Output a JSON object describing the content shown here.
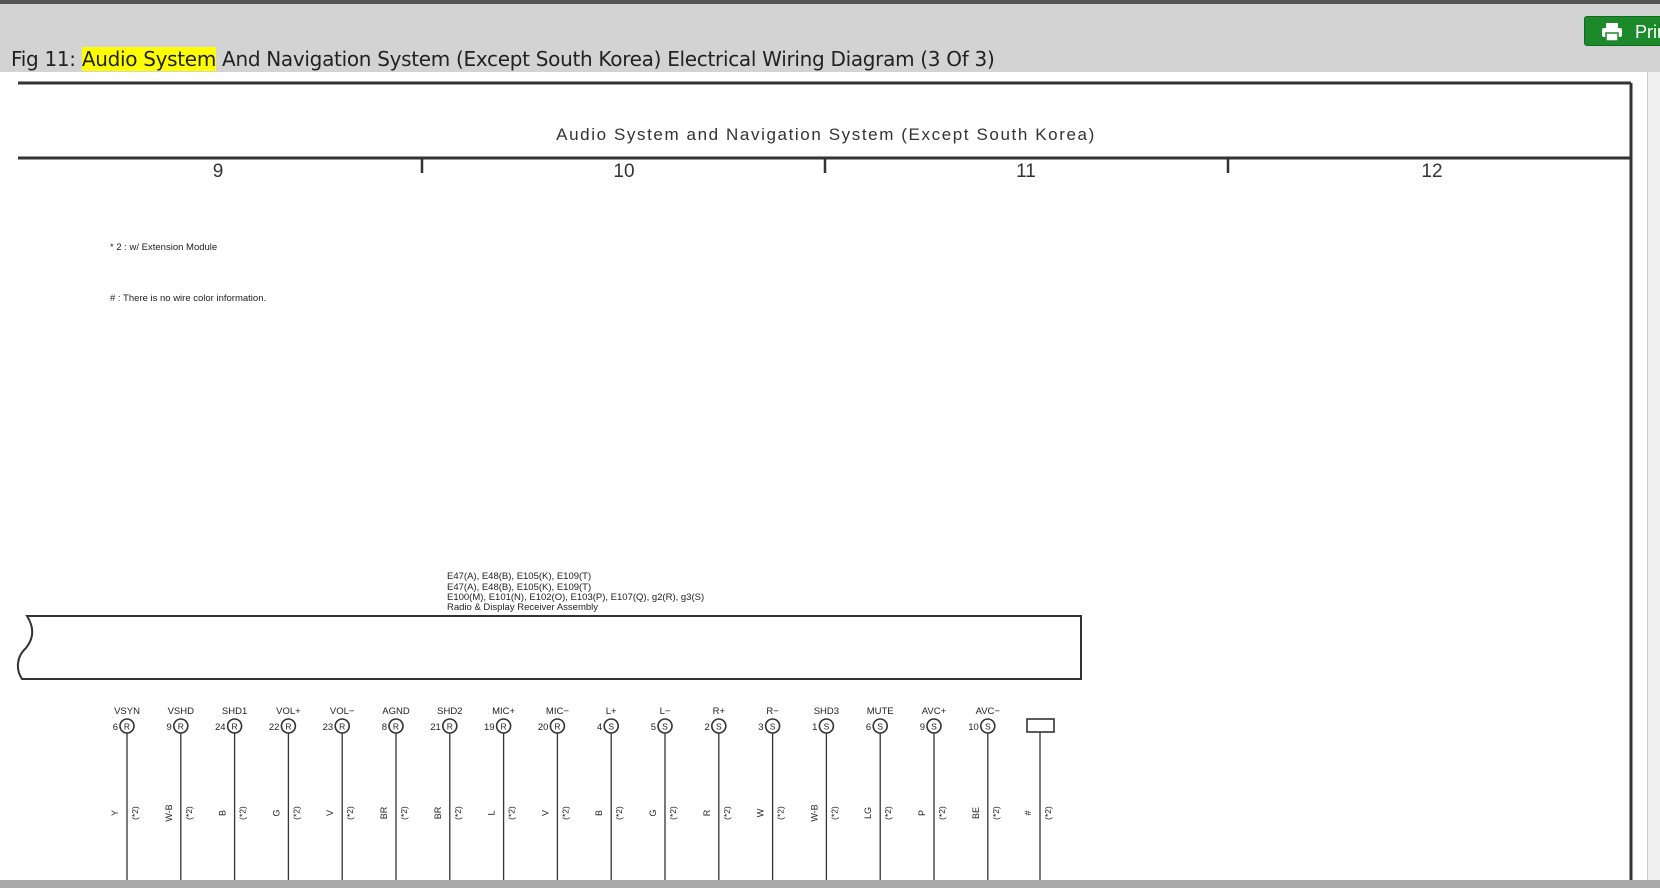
{
  "figure": {
    "prefix": "Fig 11: ",
    "highlight": "Audio System",
    "rest": " And Navigation System (Except South Korea) Electrical Wiring Diagram (3 Of 3)"
  },
  "print_button": {
    "label": "Print",
    "icon": "printer-icon"
  },
  "diagram": {
    "title": "Audio System and Navigation System (Except South Korea)",
    "columns": [
      "9",
      "10",
      "11",
      "12"
    ],
    "notes": [
      "* 2 : w/ Extension Module",
      "# : There is no wire color information."
    ],
    "connector_labels": [
      "E47(A), E48(B), E105(K), E109(T)",
      "E47(A), E48(B), E105(K), E109(T)",
      "E100(M), E101(N), E102(O), E103(P), E107(Q), g2(R), g3(S)",
      "Radio & Display Receiver Assembly"
    ],
    "pins": [
      {
        "signal": "VSYN",
        "pin": "6",
        "conn": "R",
        "wire": "Y",
        "note": "(*2)"
      },
      {
        "signal": "VSHD",
        "pin": "9",
        "conn": "R",
        "wire": "W-B",
        "note": "(*2)"
      },
      {
        "signal": "SHD1",
        "pin": "24",
        "conn": "R",
        "wire": "B",
        "note": "(*2)"
      },
      {
        "signal": "VOL+",
        "pin": "22",
        "conn": "R",
        "wire": "G",
        "note": "(*2)"
      },
      {
        "signal": "VOL−",
        "pin": "23",
        "conn": "R",
        "wire": "V",
        "note": "(*2)"
      },
      {
        "signal": "AGND",
        "pin": "8",
        "conn": "R",
        "wire": "BR",
        "note": "(*2)"
      },
      {
        "signal": "SHD2",
        "pin": "21",
        "conn": "R",
        "wire": "BR",
        "note": "(*2)"
      },
      {
        "signal": "MIC+",
        "pin": "19",
        "conn": "R",
        "wire": "L",
        "note": "(*2)"
      },
      {
        "signal": "MIC−",
        "pin": "20",
        "conn": "R",
        "wire": "V",
        "note": "(*2)"
      },
      {
        "signal": "L+",
        "pin": "4",
        "conn": "S",
        "wire": "B",
        "note": "(*2)"
      },
      {
        "signal": "L−",
        "pin": "5",
        "conn": "S",
        "wire": "G",
        "note": "(*2)"
      },
      {
        "signal": "R+",
        "pin": "2",
        "conn": "S",
        "wire": "R",
        "note": "(*2)"
      },
      {
        "signal": "R−",
        "pin": "3",
        "conn": "S",
        "wire": "W",
        "note": "(*2)"
      },
      {
        "signal": "SHD3",
        "pin": "1",
        "conn": "S",
        "wire": "W-B",
        "note": "(*2)"
      },
      {
        "signal": "MUTE",
        "pin": "6",
        "conn": "S",
        "wire": "LG",
        "note": "(*2)"
      },
      {
        "signal": "AVC+",
        "pin": "9",
        "conn": "S",
        "wire": "P",
        "note": "(*2)"
      },
      {
        "signal": "AVC−",
        "pin": "10",
        "conn": "S",
        "wire": "BE",
        "note": "(*2)"
      },
      {
        "signal": "",
        "pin": "",
        "conn": "",
        "wire": "#",
        "note": "(*2)"
      }
    ]
  }
}
